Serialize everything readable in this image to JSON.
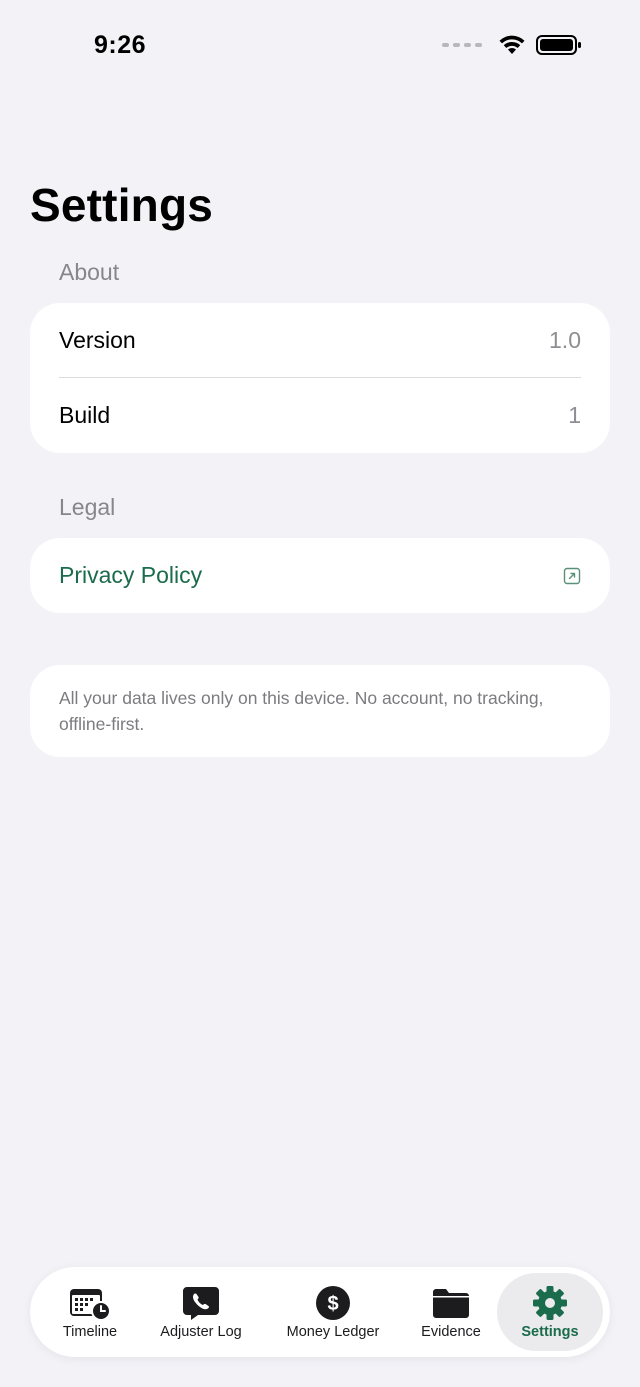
{
  "status_bar": {
    "time": "9:26"
  },
  "page": {
    "title": "Settings"
  },
  "about": {
    "header": "About",
    "rows": [
      {
        "label": "Version",
        "value": "1.0"
      },
      {
        "label": "Build",
        "value": "1"
      }
    ]
  },
  "legal": {
    "header": "Legal",
    "privacy_label": "Privacy Policy"
  },
  "info": {
    "text": "All your data lives only on this device. No account, no tracking, offline-first."
  },
  "tab_bar": {
    "tabs": [
      {
        "label": "Timeline",
        "icon": "calendar-clock-icon",
        "active": false
      },
      {
        "label": "Adjuster Log",
        "icon": "phone-bubble-icon",
        "active": false
      },
      {
        "label": "Money Ledger",
        "icon": "dollar-circle-icon",
        "active": false
      },
      {
        "label": "Evidence",
        "icon": "folder-icon",
        "active": false
      },
      {
        "label": "Settings",
        "icon": "gear-icon",
        "active": true
      }
    ]
  },
  "colors": {
    "accent": "#1b6b4d",
    "background": "#f2f2f7",
    "secondary_text": "#8e8e93"
  }
}
